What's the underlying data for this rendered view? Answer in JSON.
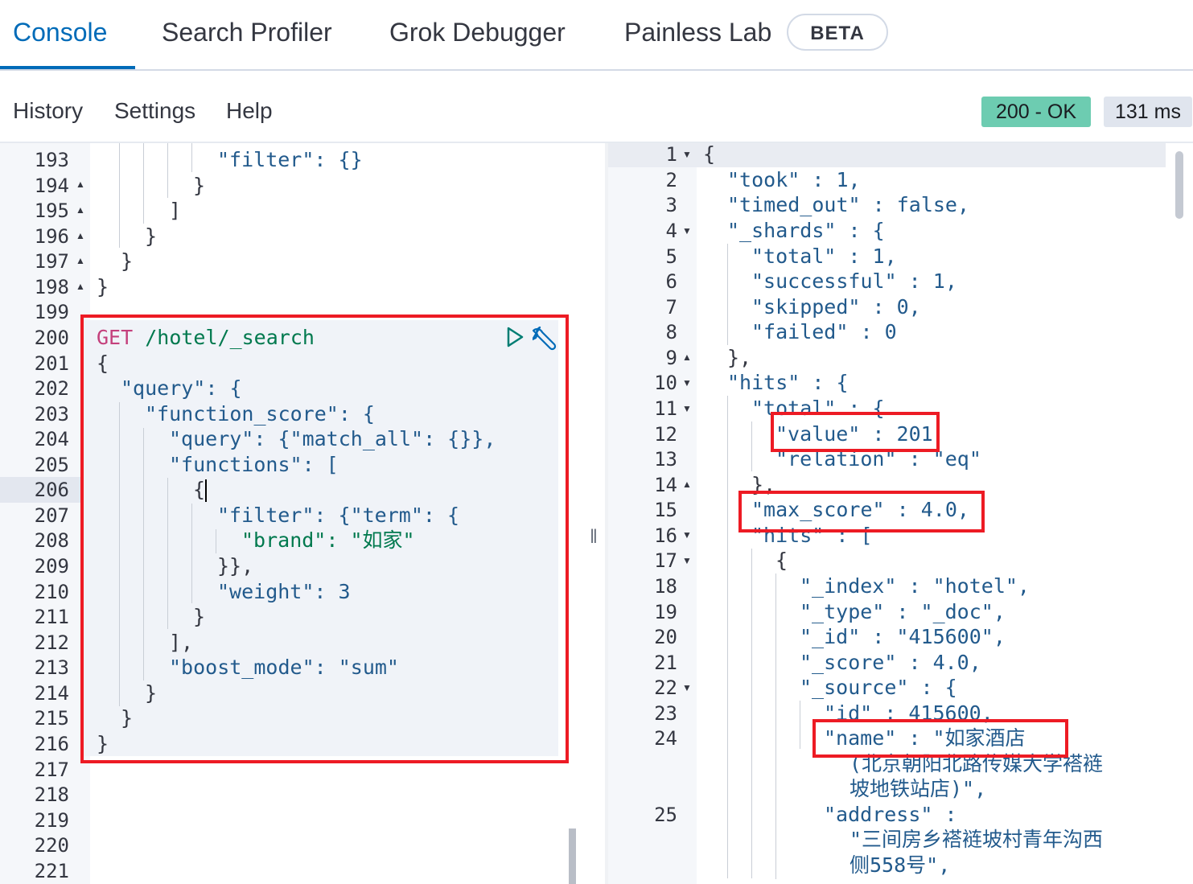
{
  "tabs": [
    {
      "label": "Console",
      "active": true
    },
    {
      "label": "Search Profiler",
      "active": false
    },
    {
      "label": "Grok Debugger",
      "active": false
    },
    {
      "label": "Painless Lab",
      "active": false
    }
  ],
  "beta_badge": "BETA",
  "toolbar": {
    "history": "History",
    "settings": "Settings",
    "help": "Help"
  },
  "status": {
    "code": "200 - OK",
    "time": "131 ms",
    "color": "#6dccb1"
  },
  "request": {
    "method": "GET",
    "path": "/hotel/_search"
  },
  "left_line_numbers": [
    "193",
    "194",
    "195",
    "196",
    "197",
    "198",
    "199",
    "200",
    "201",
    "202",
    "203",
    "204",
    "205",
    "206",
    "207",
    "208",
    "209",
    "210",
    "211",
    "212",
    "213",
    "214",
    "215",
    "216",
    "217",
    "218",
    "219",
    "220",
    "221"
  ],
  "left_code": [
    "\"filter\": {}",
    "}",
    "]",
    "}",
    "}",
    "}",
    "",
    "",
    "{",
    "\"query\": {",
    "\"function_score\": {",
    "\"query\": {\"match_all\": {}},",
    "\"functions\": [",
    "{",
    "\"filter\": {\"term\": {",
    "\"brand\": \"如家\"",
    "}},",
    "\"weight\": 3",
    "}",
    "],",
    "\"boost_mode\": \"sum\"",
    "}",
    "}",
    "}"
  ],
  "right_line_numbers": [
    "1",
    "2",
    "3",
    "4",
    "5",
    "6",
    "7",
    "8",
    "9",
    "10",
    "11",
    "12",
    "13",
    "14",
    "15",
    "16",
    "17",
    "18",
    "19",
    "20",
    "21",
    "22",
    "23",
    "24",
    "25"
  ],
  "right_code": [
    "{",
    "\"took\" : 1,",
    "\"timed_out\" : false,",
    "\"_shards\" : {",
    "\"total\" : 1,",
    "\"successful\" : 1,",
    "\"skipped\" : 0,",
    "\"failed\" : 0",
    "},",
    "\"hits\" : {",
    "\"total\" : {",
    "\"value\" : 201",
    "\"relation\" : \"eq\"",
    "},",
    "\"max_score\" : 4.0,",
    "\"hits\" : [",
    "{",
    "\"_index\" : \"hotel\",",
    "\"_type\" : \"_doc\",",
    "\"_id\" : \"415600\",",
    "\"_score\" : 4.0,",
    "\"_source\" : {",
    "\"id\" : 415600,",
    "\"name\" : \"如家酒店",
    "(北京朝阳北路传媒大学褡裢",
    "坡地铁站店)\",",
    "\"address\" :",
    "\"三间房乡褡裢坡村青年沟西",
    "侧558号\","
  ],
  "icons": [
    "play-icon",
    "wrench-icon",
    "fold-arrow-icon"
  ]
}
